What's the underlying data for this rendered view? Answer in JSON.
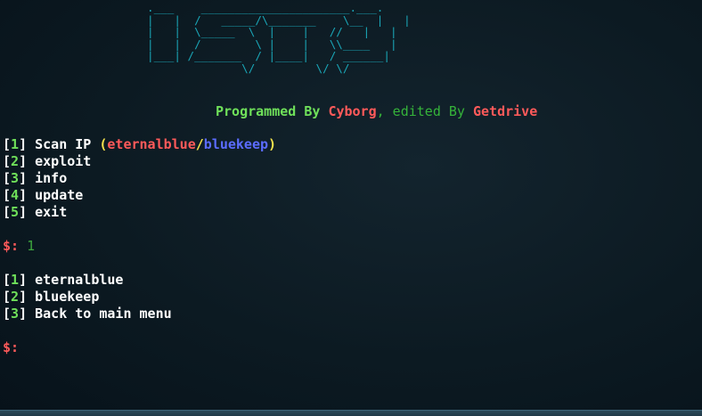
{
  "banner_art": ".___    ______________________.___.\n|   |  /   _____/\\_______    \\__  |   |\n|   |  \\_____  \\  |    |   //   |   |\n|   |  /        \\ |    |   \\\\____   |\n|___| /_______  / |____|   / ______|\n              \\/         \\/ \\/",
  "credits": {
    "programmed_by": "Programmed By ",
    "author": "Cyborg",
    "edited_by": ", edited By ",
    "editor": "Getdrive"
  },
  "main_menu": [
    {
      "num": "1",
      "label": "Scan IP ",
      "extra": {
        "open": "(",
        "opt1": "eternalblue",
        "sep": "/",
        "opt2": "bluekeep",
        "close": ")"
      }
    },
    {
      "num": "2",
      "label": "exploit"
    },
    {
      "num": "3",
      "label": "info"
    },
    {
      "num": "4",
      "label": "update"
    },
    {
      "num": "5",
      "label": "exit"
    }
  ],
  "prompt_symbol": "$:",
  "first_input": "1",
  "sub_menu": [
    {
      "num": "1",
      "label": "eternalblue"
    },
    {
      "num": "2",
      "label": "bluekeep"
    },
    {
      "num": "3",
      "label": "Back to main menu"
    }
  ],
  "colors": {
    "banner": "#1aa6b7",
    "accent_red": "#ff5a5a",
    "accent_green": "#6fe05a",
    "accent_blue": "#5b6cff",
    "accent_yellow": "#f2e14c",
    "background": "#0c1a22"
  }
}
